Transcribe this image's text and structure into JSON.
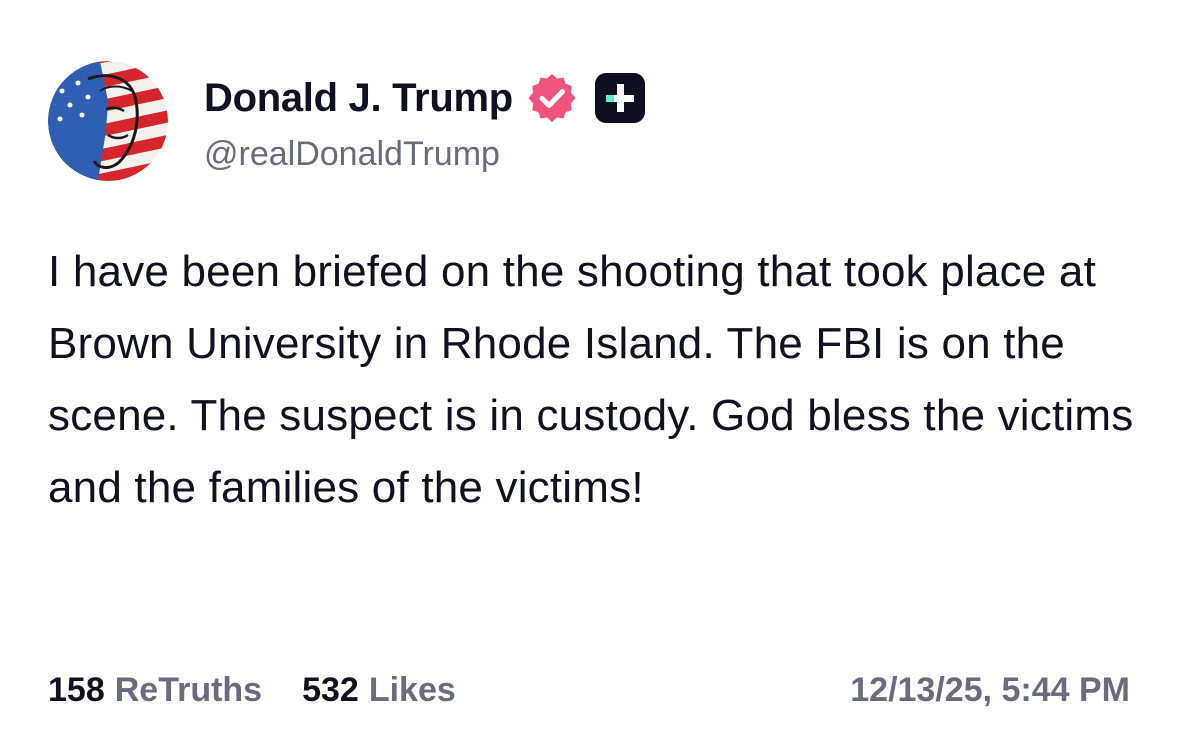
{
  "author": {
    "display_name": "Donald J. Trump",
    "handle": "@realDonaldTrump",
    "verified_color": "#f0547c",
    "badge_color": "#0f0f23",
    "badge_accent": "#5ef2c8"
  },
  "post": {
    "text": "I have been briefed on the shooting that took place at Brown University in Rhode Island. The FBI is on the scene. The suspect is in custody. God bless the victims and the families of the victims!",
    "retruths_count": "158",
    "retruths_label": "ReTruths",
    "likes_count": "532",
    "likes_label": "Likes",
    "timestamp": "12/13/25, 5:44 PM"
  }
}
